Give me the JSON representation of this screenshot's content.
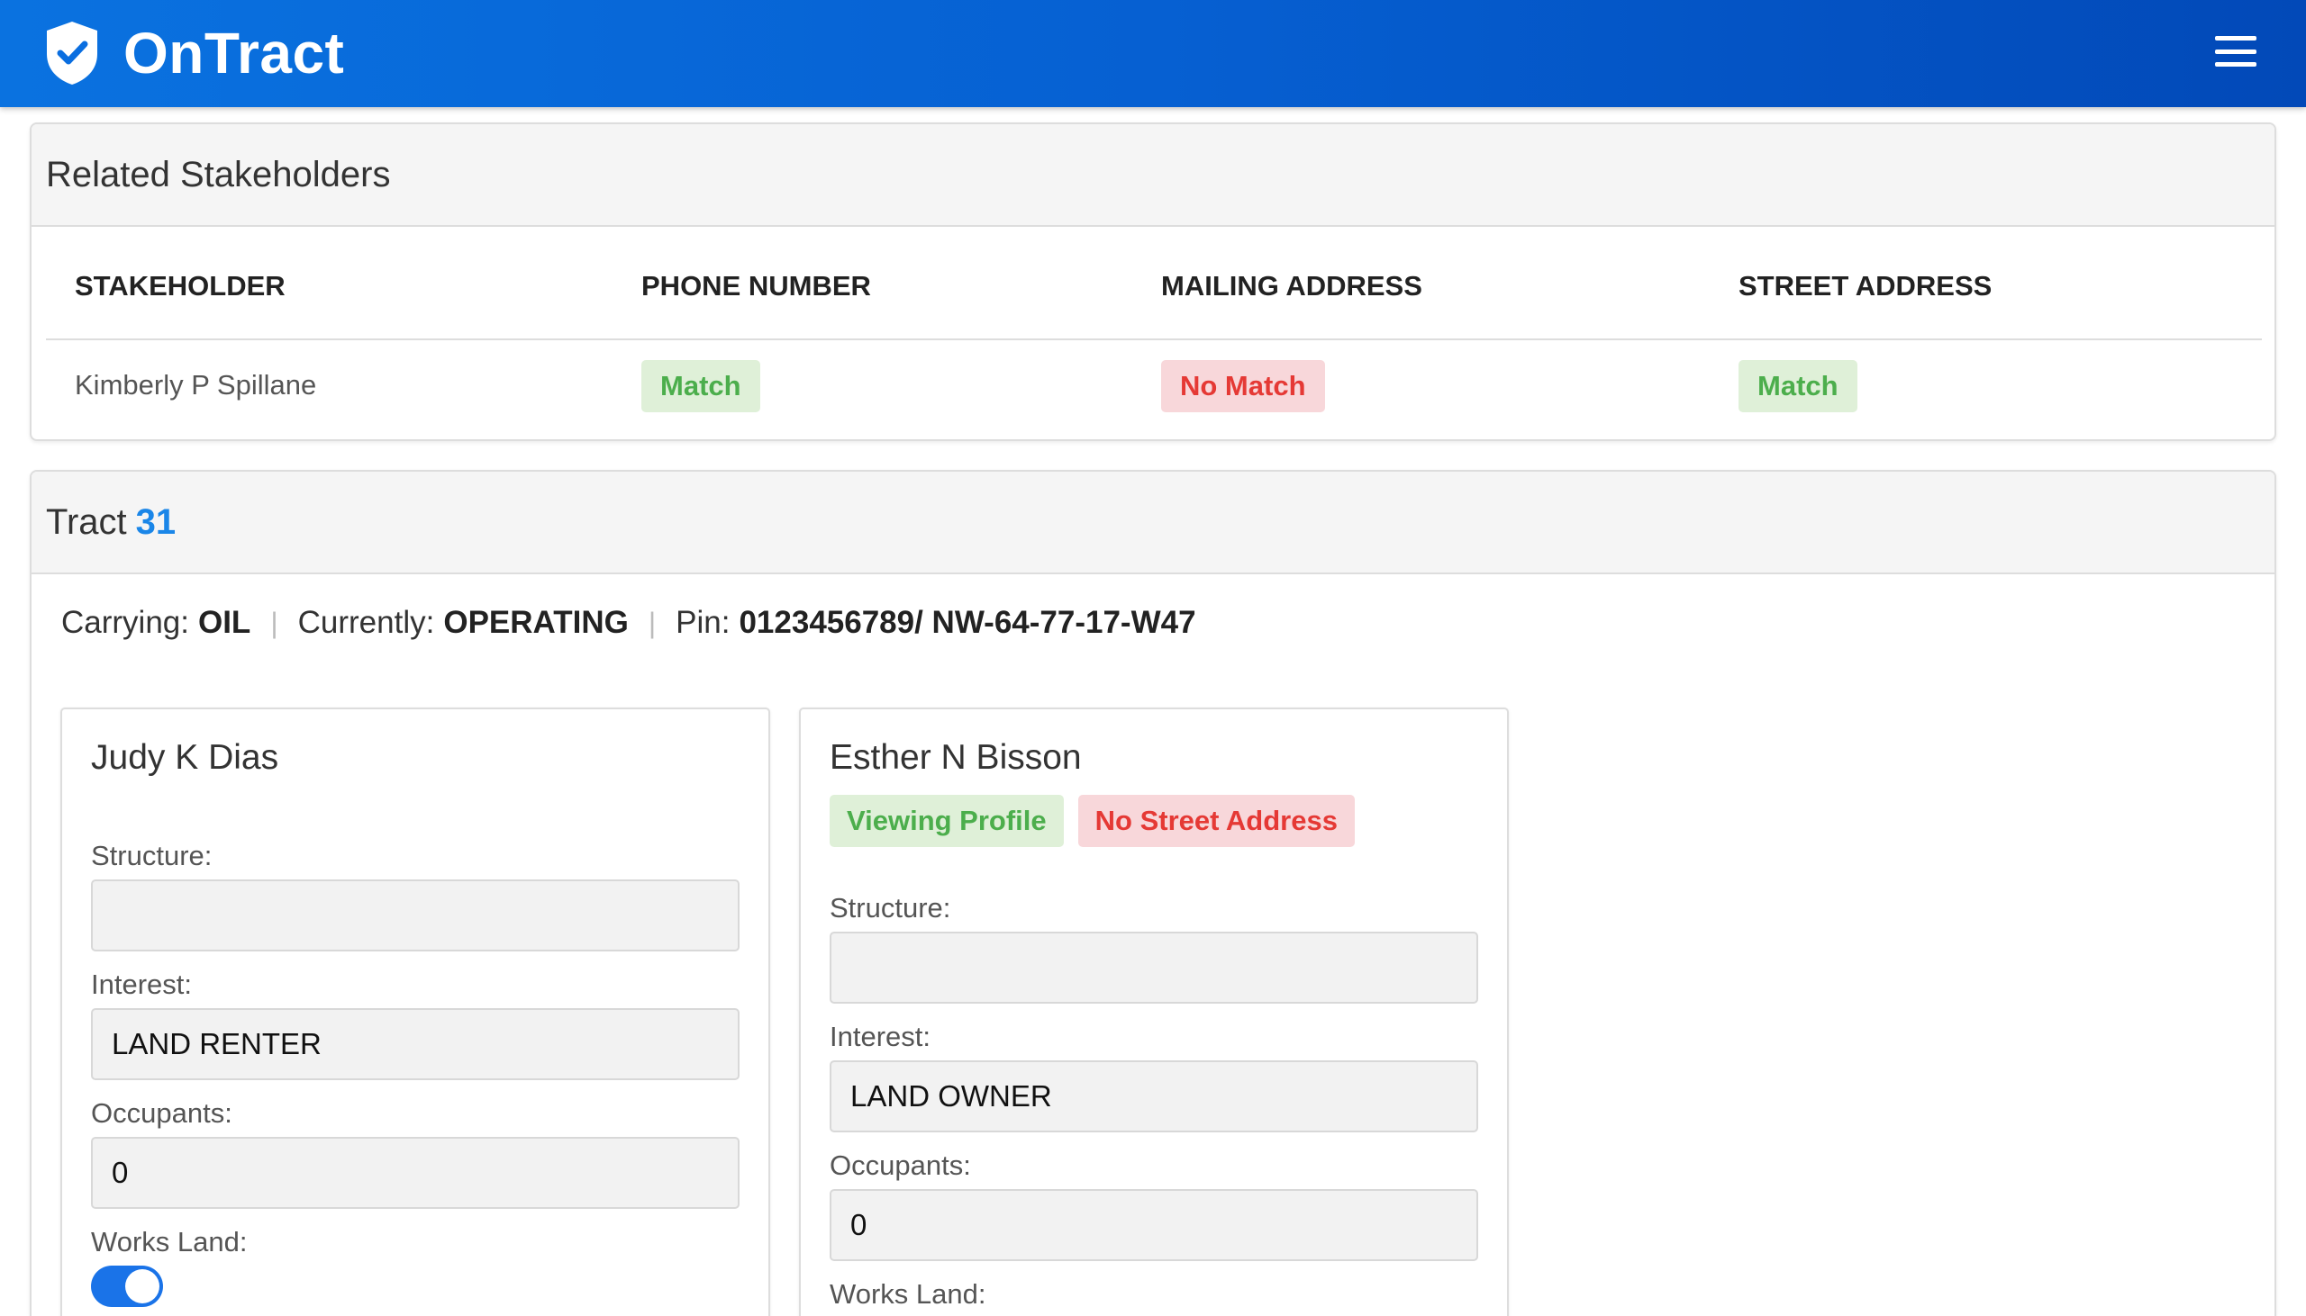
{
  "app": {
    "name": "OnTract",
    "logo_icon": "shield-check-icon",
    "menu_icon": "hamburger-menu-icon"
  },
  "colors": {
    "header_start": "#0a72e0",
    "header_end": "#0249b8",
    "match": "#4cae4c",
    "no_match": "#e53935",
    "accent": "#1a86e8"
  },
  "stakeholders": {
    "title": "Related Stakeholders",
    "columns": [
      "STAKEHOLDER",
      "PHONE NUMBER",
      "MAILING ADDRESS",
      "STREET ADDRESS"
    ],
    "rows": [
      {
        "name": "Kimberly P Spillane",
        "phone": "Match",
        "mailing": "No Match",
        "street": "Match"
      }
    ]
  },
  "tract": {
    "label": "Tract",
    "number": "31",
    "carrying_label": "Carrying:",
    "carrying": "OIL",
    "currently_label": "Currently:",
    "currently": "OPERATING",
    "pin_label": "Pin:",
    "pin": "0123456789/ NW-64-77-17-W47",
    "separator": "|",
    "people": [
      {
        "name": "Judy K Dias",
        "badges": [],
        "structure_label": "Structure:",
        "structure": "",
        "interest_label": "Interest:",
        "interest": "LAND RENTER",
        "occupants_label": "Occupants:",
        "occupants": "0",
        "works_land_label": "Works Land:",
        "works_land": true
      },
      {
        "name": "Esther N Bisson",
        "badges": [
          "Viewing Profile",
          "No Street Address"
        ],
        "structure_label": "Structure:",
        "structure": "",
        "interest_label": "Interest:",
        "interest": "LAND OWNER",
        "occupants_label": "Occupants:",
        "occupants": "0",
        "works_land_label": "Works Land:"
      }
    ]
  }
}
